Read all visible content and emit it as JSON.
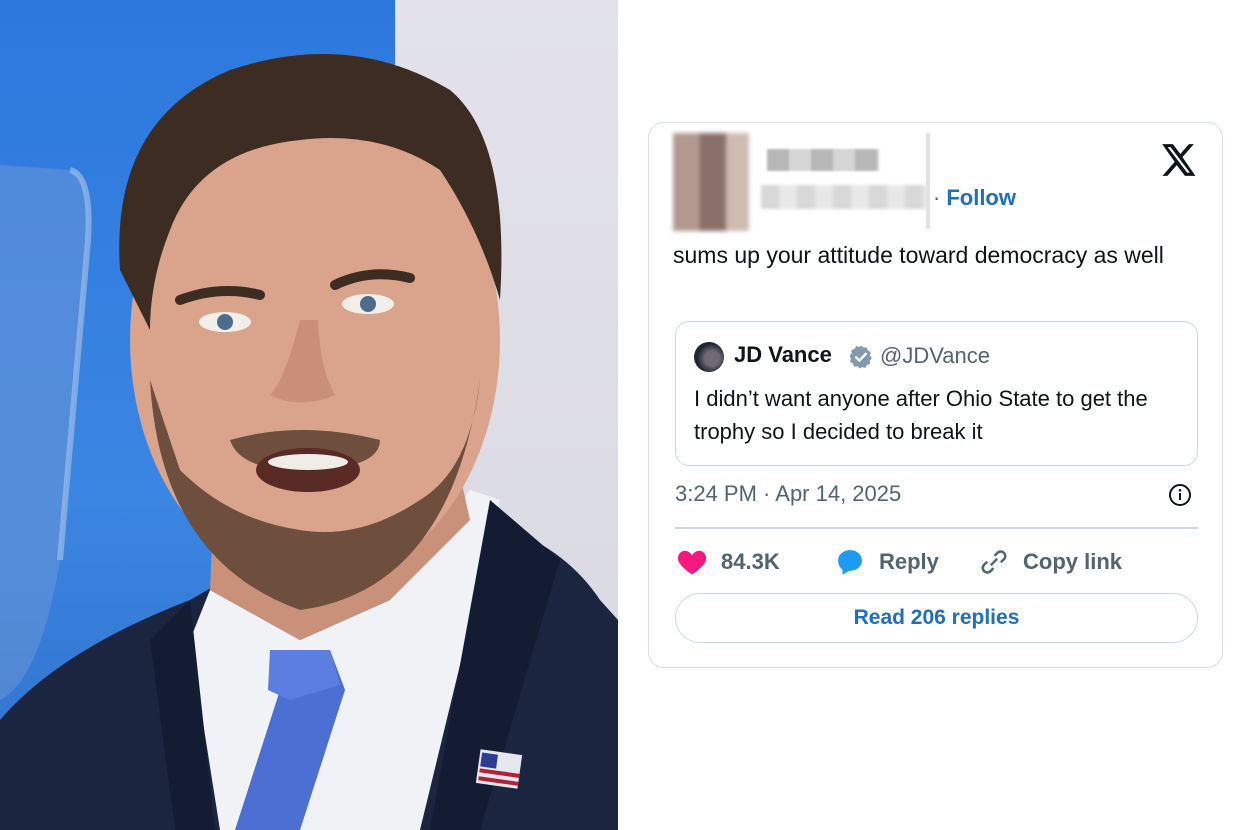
{
  "photo": {
    "subject": "man-speaking-photo"
  },
  "tweet": {
    "follow_label": "Follow",
    "follow_separator": "·",
    "text": "sums up your attitude toward democracy as well",
    "quoted": {
      "name": "JD Vance",
      "handle": "@JDVance",
      "text": "I didn’t want anyone after Ohio State to get the trophy so I decided to break it"
    },
    "timestamp": "3:24 PM · Apr 14, 2025",
    "likes": "84.3K",
    "reply_label": "Reply",
    "copy_link_label": "Copy link",
    "read_replies_label": "Read 206 replies"
  },
  "colors": {
    "link_blue": "#1d6fbf",
    "heart_pink": "#f91880",
    "reply_blue": "#1d9bf0",
    "muted": "#536471"
  }
}
